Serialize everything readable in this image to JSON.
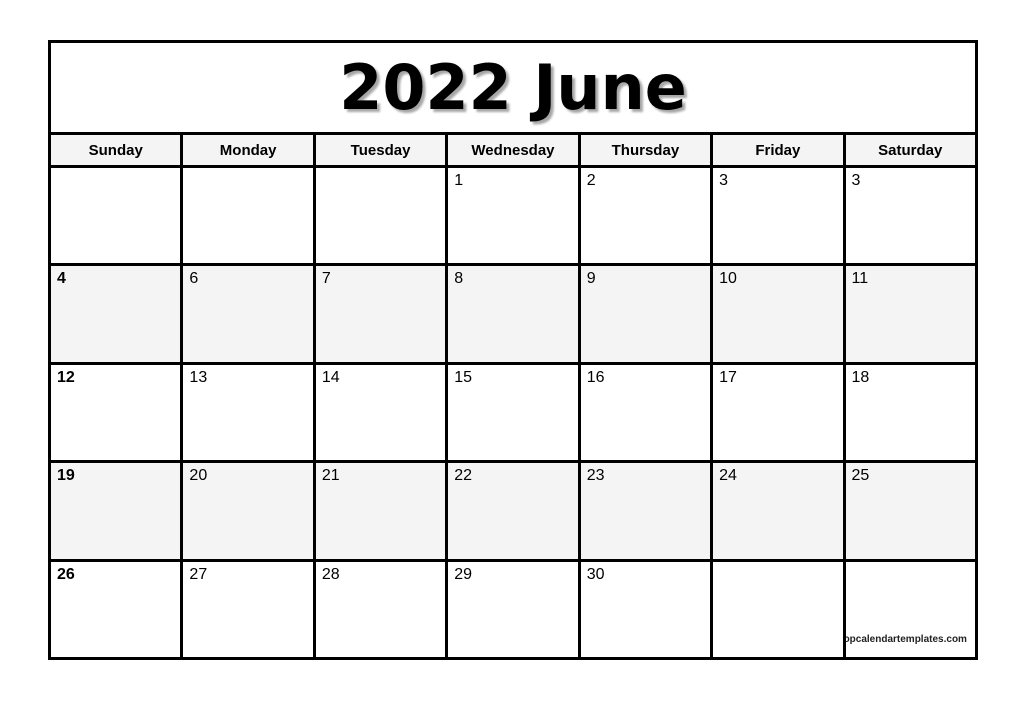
{
  "calendar": {
    "title": "2022 June",
    "year": "2022",
    "month": "June",
    "weekdays": [
      {
        "label": "Sunday"
      },
      {
        "label": "Monday"
      },
      {
        "label": "Tuesday"
      },
      {
        "label": "Wednesday"
      },
      {
        "label": "Thursday"
      },
      {
        "label": "Friday"
      },
      {
        "label": "Saturday"
      }
    ],
    "weeks": [
      {
        "shaded": false,
        "days": [
          {
            "number": ""
          },
          {
            "number": ""
          },
          {
            "number": ""
          },
          {
            "number": "1"
          },
          {
            "number": "2"
          },
          {
            "number": "3"
          },
          {
            "number": "3"
          }
        ]
      },
      {
        "shaded": true,
        "days": [
          {
            "number": "4"
          },
          {
            "number": "6"
          },
          {
            "number": "7"
          },
          {
            "number": "8"
          },
          {
            "number": "9"
          },
          {
            "number": "10"
          },
          {
            "number": "11"
          }
        ]
      },
      {
        "shaded": false,
        "days": [
          {
            "number": "12"
          },
          {
            "number": "13"
          },
          {
            "number": "14"
          },
          {
            "number": "15"
          },
          {
            "number": "16"
          },
          {
            "number": "17"
          },
          {
            "number": "18"
          }
        ]
      },
      {
        "shaded": true,
        "days": [
          {
            "number": "19"
          },
          {
            "number": "20"
          },
          {
            "number": "21"
          },
          {
            "number": "22"
          },
          {
            "number": "23"
          },
          {
            "number": "24"
          },
          {
            "number": "25"
          }
        ]
      },
      {
        "shaded": false,
        "days": [
          {
            "number": "26"
          },
          {
            "number": "27"
          },
          {
            "number": "28"
          },
          {
            "number": "29"
          },
          {
            "number": "30"
          },
          {
            "number": ""
          },
          {
            "number": ""
          }
        ]
      }
    ],
    "watermark": "topcalendartemplates.com",
    "colors": {
      "border": "#000000",
      "shaded_row_bg": "#f4f4f4",
      "header_bg": "#f4f4f4",
      "page_bg": "#ffffff",
      "text": "#000000"
    }
  }
}
